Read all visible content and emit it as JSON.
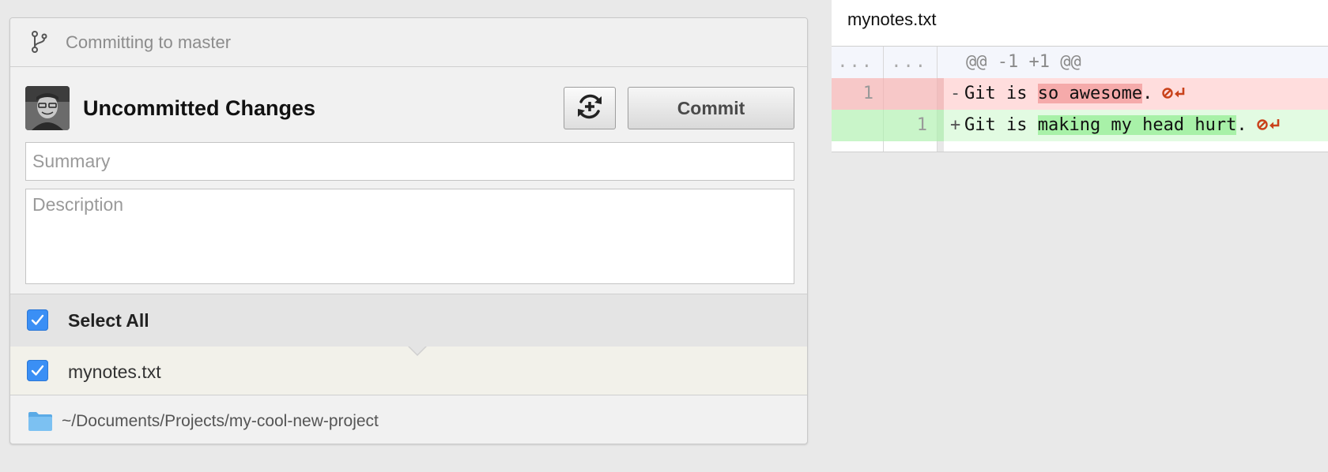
{
  "branch": {
    "label": "Committing to master",
    "icon": "branch-icon"
  },
  "commit_area": {
    "title": "Uncommitted Changes",
    "commit_label": "Commit",
    "summary_placeholder": "Summary",
    "description_placeholder": "Description"
  },
  "files": {
    "select_all_label": "Select All",
    "select_all_checked": true,
    "items": [
      {
        "name": "mynotes.txt",
        "checked": true
      }
    ]
  },
  "repo_path": "~/Documents/Projects/my-cool-new-project",
  "diff": {
    "filename": "mynotes.txt",
    "hunk": {
      "old_gutter": "...",
      "new_gutter": "...",
      "header": "@@ -1 +1 @@"
    },
    "lines": [
      {
        "type": "deletion",
        "old_no": "1",
        "new_no": "",
        "sign": "-",
        "prefix": "Git is ",
        "changed": "so awesome",
        "suffix": "."
      },
      {
        "type": "addition",
        "old_no": "",
        "new_no": "1",
        "sign": "+",
        "prefix": "Git is ",
        "changed": "making my head hurt",
        "suffix": "."
      }
    ]
  },
  "colors": {
    "accent_checkbox": "#3a8ff5",
    "deletion_bg": "#ffdddd",
    "deletion_highlight": "#f5aaaa",
    "addition_bg": "#e2fbe2",
    "addition_highlight": "#a8f1a8",
    "eol_marker": "#c9421b"
  }
}
